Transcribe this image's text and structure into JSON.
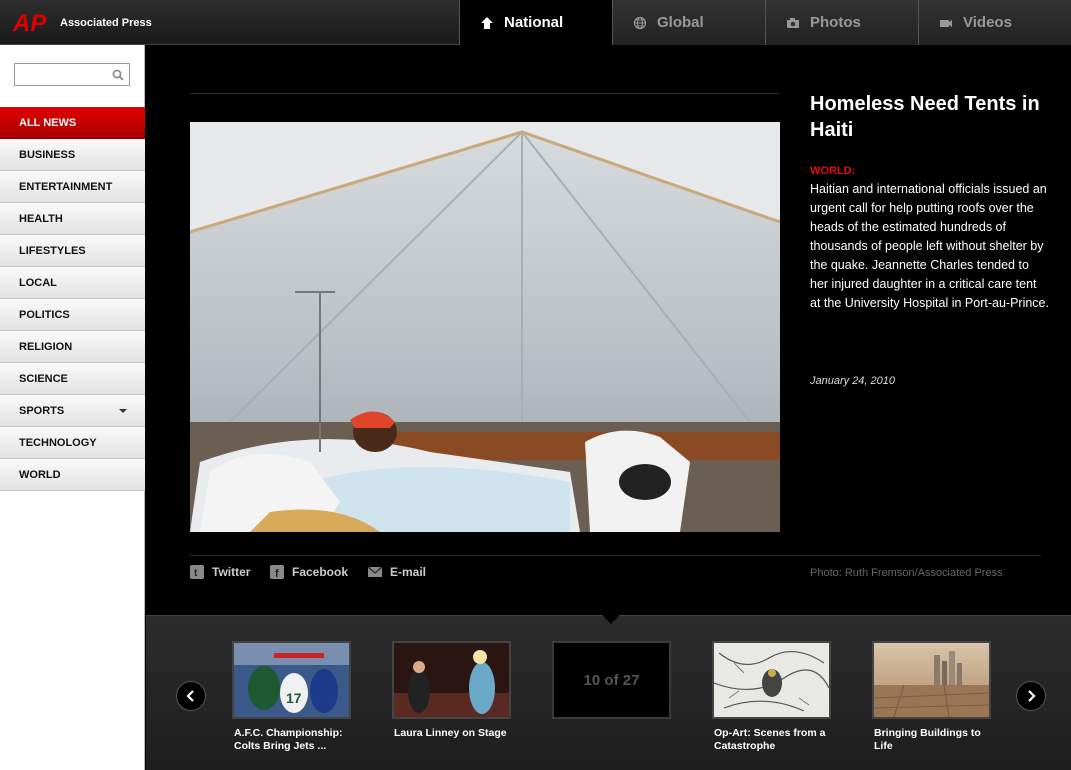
{
  "header": {
    "brand": "Associated Press",
    "logo_text": "AP",
    "tabs": [
      {
        "label": "National",
        "icon": "home-icon",
        "active": true
      },
      {
        "label": "Global",
        "icon": "globe-icon",
        "active": false
      },
      {
        "label": "Photos",
        "icon": "camera-icon",
        "active": false
      },
      {
        "label": "Videos",
        "icon": "video-camera-icon",
        "active": false
      }
    ]
  },
  "sidebar": {
    "search": {
      "value": "",
      "placeholder": ""
    },
    "items": [
      {
        "label": "ALL NEWS",
        "active": true
      },
      {
        "label": "BUSINESS"
      },
      {
        "label": "ENTERTAINMENT"
      },
      {
        "label": "HEALTH"
      },
      {
        "label": "LIFESTYLES"
      },
      {
        "label": "LOCAL"
      },
      {
        "label": "POLITICS"
      },
      {
        "label": "RELIGION"
      },
      {
        "label": "SCIENCE"
      },
      {
        "label": "SPORTS",
        "has_dropdown": true
      },
      {
        "label": "TECHNOLOGY"
      },
      {
        "label": "WORLD"
      }
    ]
  },
  "article": {
    "headline": "Homeless Need Tents in Haiti",
    "section": "WORLD:",
    "body": "Haitian and international officials issued an urgent call for help putting roofs over the heads of the estimated hundreds of thousands of people left without shelter by the quake. Jeannette Charles tended to her injured daughter in a critical care tent at the University Hospital in Port-au-Prince.",
    "date": "January 24, 2010",
    "credit": "Photo: Ruth Fremson/Associated Press"
  },
  "share": {
    "twitter": "Twitter",
    "facebook": "Facebook",
    "email": "E-mail"
  },
  "filmstrip": {
    "counter": "10 of 27",
    "thumbs": [
      {
        "caption": "A.F.C. Championship: Colts Bring Jets ..."
      },
      {
        "caption": "Laura Linney on Stage"
      },
      {
        "caption": "Op-Art: Scenes from a Catastrophe"
      },
      {
        "caption": "Bringing Buildings to Life"
      }
    ]
  },
  "colors": {
    "accent_red": "#d40000",
    "background": "#000000",
    "sidebar_bg": "#ffffff"
  }
}
